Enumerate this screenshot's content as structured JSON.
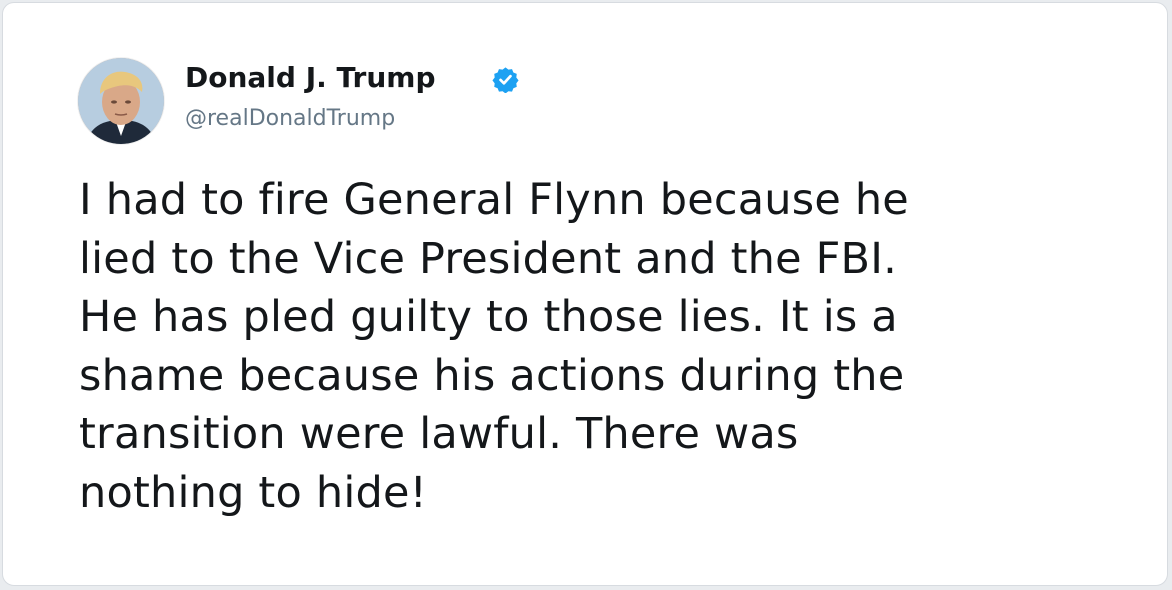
{
  "tweet": {
    "author": {
      "display_name": "Donald J. Trump",
      "handle": "@realDonaldTrump",
      "verified": true,
      "avatar_icon": "profile-photo-avatar"
    },
    "text": "I had to fire General Flynn because he\nlied to the Vice President and the FBI.\nHe has pled guilty to those lies. It is a\nshame because his actions during the\ntransition were lawful. There was\nnothing to hide!"
  },
  "colors": {
    "verified_badge": "#1da1f2",
    "name_text": "#14171a",
    "handle_text": "#657786",
    "card_background": "#ffffff"
  }
}
